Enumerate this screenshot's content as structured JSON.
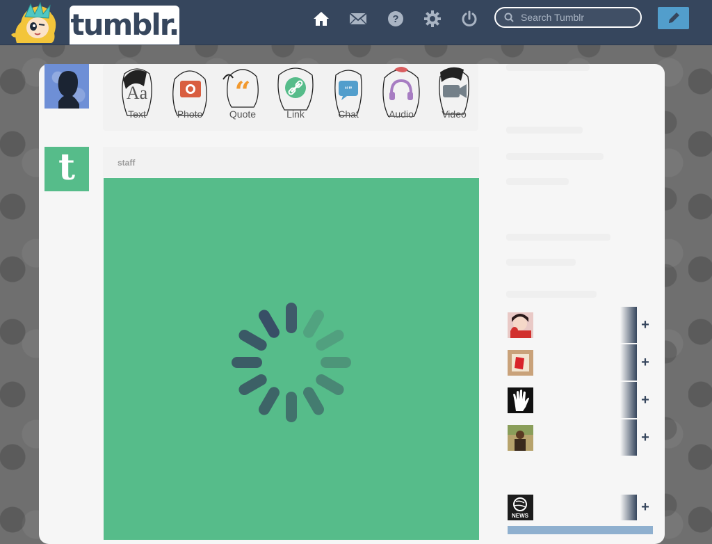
{
  "header": {
    "logo_text": "tumblr.",
    "nav": [
      {
        "name": "home-icon"
      },
      {
        "name": "mail-icon"
      },
      {
        "name": "help-icon"
      },
      {
        "name": "gear-icon"
      },
      {
        "name": "power-icon"
      }
    ],
    "search": {
      "placeholder": "Search Tumblr",
      "value": ""
    },
    "compose_icon": "pencil-icon"
  },
  "post_types": [
    {
      "label": "Text",
      "icon": "text-icon",
      "color": "#555555"
    },
    {
      "label": "Photo",
      "icon": "camera-icon",
      "color": "#d95e40"
    },
    {
      "label": "Quote",
      "icon": "quote-icon",
      "color": "#f2992e"
    },
    {
      "label": "Link",
      "icon": "link-icon",
      "color": "#56bc8a"
    },
    {
      "label": "Chat",
      "icon": "chat-icon",
      "color": "#529ecc"
    },
    {
      "label": "Audio",
      "icon": "headphones-icon",
      "color": "#a77dc2"
    },
    {
      "label": "Video",
      "icon": "video-camera-icon",
      "color": "#748089"
    }
  ],
  "post": {
    "author": "staff",
    "media_color": "#56bc8a",
    "status": "loading-spinner"
  },
  "recommended": [
    {
      "avatar": "avatar-girl-red"
    },
    {
      "avatar": "avatar-red-painting"
    },
    {
      "avatar": "avatar-hand"
    },
    {
      "avatar": "avatar-person-outdoor"
    },
    {
      "avatar": "avatar-discovery-news",
      "avatar_text": "NEWS"
    }
  ],
  "follow_symbol": "+",
  "colors": {
    "header_bg": "#36465d",
    "accent": "#529ecc",
    "staff_green": "#56bc8a"
  }
}
